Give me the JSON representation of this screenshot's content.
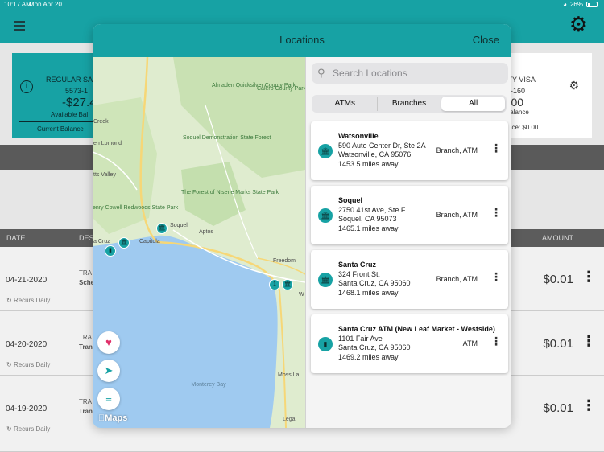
{
  "status_bar": {
    "time": "10:17 AM",
    "date": "Mon Apr 20",
    "battery": "26%"
  },
  "colors": {
    "accent": "#17a2a4",
    "favorite": "#e0306a"
  },
  "accounts": {
    "left": {
      "name": "REGULAR SA",
      "number": "5573-1",
      "balance": "-$27.4",
      "available_label": "Available Bal",
      "current_label": "Current Balance"
    },
    "right": {
      "name": "UNITY VISA",
      "number": "990-160",
      "balance": "50.00",
      "available_label": "ble Balance",
      "current_label": "Balance: $0.00"
    }
  },
  "table": {
    "headers": {
      "date": "DATE",
      "description": "DES",
      "amount": "AMOUNT"
    },
    "rows": [
      {
        "date": "04-21-2020",
        "desc1": "TRA",
        "desc2": "Sche",
        "amount": "$0.01",
        "recurs": "Recurs Daily"
      },
      {
        "date": "04-20-2020",
        "desc1": "TRA",
        "desc2": "Tran try a",
        "amount": "$0.01",
        "recurs": "Recurs Daily"
      },
      {
        "date": "04-19-2020",
        "desc1": "TRA",
        "desc2": "Tran try a",
        "amount": "$0.01",
        "recurs": "Recurs Daily"
      }
    ]
  },
  "modal": {
    "title": "Locations",
    "close_label": "Close",
    "search": {
      "placeholder": "Search Locations",
      "value": ""
    },
    "filters": {
      "atms": "ATMs",
      "branches": "Branches",
      "all": "All",
      "selected": "All"
    },
    "locations": [
      {
        "name": "Watsonville",
        "address1": "590 Auto Center Dr, Ste 2A",
        "address2": "Watsonville, CA 95076",
        "distance": "1453.5 miles away",
        "type": "Branch, ATM",
        "icon": "bank-icon"
      },
      {
        "name": "Soquel",
        "address1": "2750 41st Ave, Ste F",
        "address2": "Soquel, CA 95073",
        "distance": "1465.1 miles away",
        "type": "Branch, ATM",
        "icon": "bank-icon"
      },
      {
        "name": "Santa Cruz",
        "address1": "324 Front St.",
        "address2": "Santa Cruz, CA 95060",
        "distance": "1468.1 miles away",
        "type": "Branch, ATM",
        "icon": "bank-icon"
      },
      {
        "name": "Santa Cruz ATM (New Leaf Market - Westside)",
        "address1": "1101 Fair Ave",
        "address2": "Santa Cruz, CA 95060",
        "distance": "1469.2 miles away",
        "type": "ATM",
        "icon": "atm-icon"
      }
    ],
    "map": {
      "labels": {
        "almaden": "Almaden Quicksilver County Park",
        "calero": "Calero County Park",
        "creek": "Creek",
        "ben_lomond": "en Lomond",
        "soquel_forest": "Soquel Demonstration State Forest",
        "scotts_valley": "tts Valley",
        "nisene": "The Forest of Nisene Marks State Park",
        "cowell": "enry Cowell Redwoods State Park",
        "soquel": "Soquel",
        "aptos": "Aptos",
        "santa_cruz": "a Cruz",
        "capitola": "Capitola",
        "freedom": "Freedom",
        "moss_landing": "Moss La",
        "monterey_bay": "Monterey Bay",
        "w": "W"
      },
      "maps_brand": "Maps",
      "legal": "Legal"
    }
  }
}
